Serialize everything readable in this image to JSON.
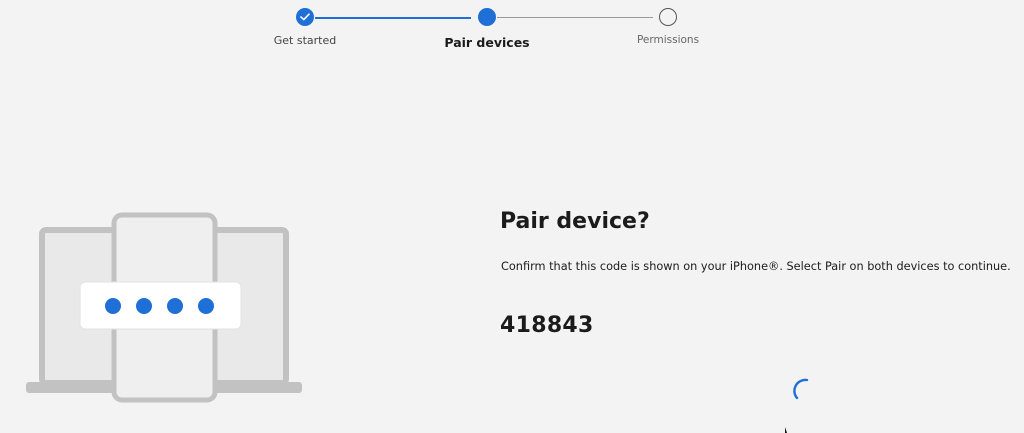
{
  "stepper": {
    "steps": [
      {
        "label": "Get started",
        "state": "completed"
      },
      {
        "label": "Pair devices",
        "state": "current"
      },
      {
        "label": "Permissions",
        "state": "pending"
      }
    ]
  },
  "illustration": {
    "icons": [
      "laptop-icon",
      "phone-icon",
      "laptop-icon"
    ],
    "code_dots": 4
  },
  "content": {
    "title": "Pair device?",
    "message": "Confirm that this code is shown on your iPhone®. Select Pair on both devices to continue.",
    "code": "418843"
  },
  "colors": {
    "accent": "#1e6fd6",
    "background": "#f3f3f3",
    "text": "#1b1b1b"
  },
  "status": {
    "loading_icon": "spinner-icon"
  }
}
